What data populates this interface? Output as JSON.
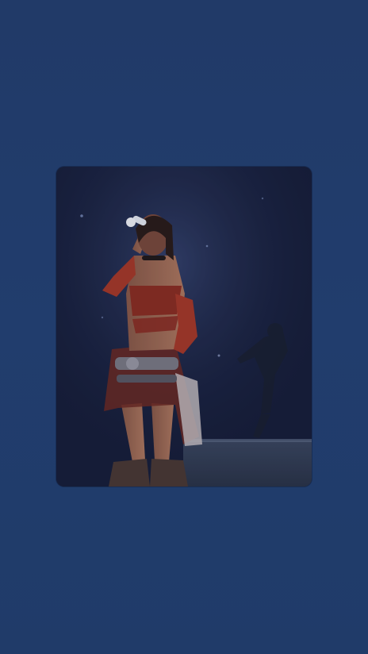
{
  "screen": {
    "background_color": "#213c6b"
  },
  "media": {
    "kind": "photo",
    "subject_icon": "performer-photo"
  }
}
